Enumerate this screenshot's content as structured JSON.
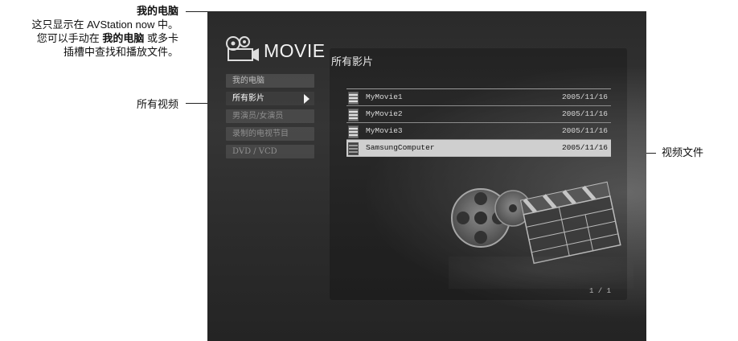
{
  "annotations": {
    "my_computer_title": "我的电脑",
    "desc_line1": "这只显示在 AVStation now 中。",
    "desc_line2_pre": "您可以手动在 ",
    "desc_line2_bold": "我的电脑",
    "desc_line2_post": " 或多卡",
    "desc_line3": "插槽中查找和播放文件。",
    "all_videos": "所有视频",
    "video_file": "视频文件"
  },
  "screen": {
    "app_title": "MOVIE",
    "panel_title": "所有影片",
    "sidebar": [
      {
        "label": "我的电脑"
      },
      {
        "label": "所有影片"
      },
      {
        "label": "男演员/女演员"
      },
      {
        "label": "录制的电视节目"
      },
      {
        "label": "DVD / VCD"
      }
    ],
    "files": [
      {
        "name": "MyMovie1",
        "date": "2005/11/16"
      },
      {
        "name": "MyMovie2",
        "date": "2005/11/16"
      },
      {
        "name": "MyMovie3",
        "date": "2005/11/16"
      },
      {
        "name": "SamsungComputer",
        "date": "2005/11/16"
      }
    ],
    "page_indicator": "1 / 1"
  },
  "icons": {
    "logo": "film-camera-icon",
    "file": "film-strip-icon",
    "arrow": "play-arrow-icon"
  }
}
